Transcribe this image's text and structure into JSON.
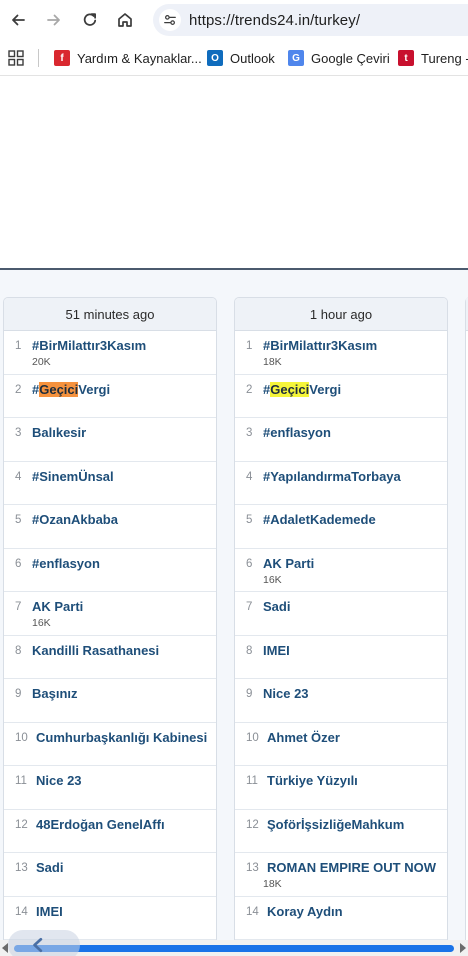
{
  "browser": {
    "url": "https://trends24.in/turkey/",
    "bookmarks": [
      {
        "label": "Yardım & Kaynaklar...",
        "icon": "help-resources-icon",
        "color": "#d9282f",
        "glyph": "f"
      },
      {
        "label": "Outlook",
        "icon": "outlook-icon",
        "color": "#0f6cbd",
        "glyph": "O"
      },
      {
        "label": "Google Çeviri",
        "icon": "google-translate-icon",
        "color": "#4f86ec",
        "glyph": "G"
      },
      {
        "label": "Tureng -",
        "icon": "tureng-icon",
        "color": "#c8102e",
        "glyph": "t"
      }
    ]
  },
  "columns": [
    {
      "header": "51 minutes ago",
      "trends": [
        {
          "rank": "1",
          "parts": [
            {
              "text": "#BirMilattır3Kasım"
            }
          ],
          "count": "20K"
        },
        {
          "rank": "2",
          "parts": [
            {
              "text": "#"
            },
            {
              "text": "Geçici",
              "hl": "orange"
            },
            {
              "text": "Vergi"
            }
          ],
          "count": ""
        },
        {
          "rank": "3",
          "parts": [
            {
              "text": "Balıkesir"
            }
          ],
          "count": ""
        },
        {
          "rank": "4",
          "parts": [
            {
              "text": "#SinemÜnsal"
            }
          ],
          "count": ""
        },
        {
          "rank": "5",
          "parts": [
            {
              "text": "#OzanAkbaba"
            }
          ],
          "count": ""
        },
        {
          "rank": "6",
          "parts": [
            {
              "text": "#enflasyon"
            }
          ],
          "count": ""
        },
        {
          "rank": "7",
          "parts": [
            {
              "text": "AK Parti"
            }
          ],
          "count": "16K"
        },
        {
          "rank": "8",
          "parts": [
            {
              "text": "Kandilli Rasathanesi"
            }
          ],
          "count": ""
        },
        {
          "rank": "9",
          "parts": [
            {
              "text": "Başınız"
            }
          ],
          "count": ""
        },
        {
          "rank": "10",
          "parts": [
            {
              "text": "Cumhurbaşkanlığı Kabinesi"
            }
          ],
          "count": ""
        },
        {
          "rank": "11",
          "parts": [
            {
              "text": "Nice 23"
            }
          ],
          "count": ""
        },
        {
          "rank": "12",
          "parts": [
            {
              "text": "48Erdoğan GenelAffı"
            }
          ],
          "count": ""
        },
        {
          "rank": "13",
          "parts": [
            {
              "text": "Sadi"
            }
          ],
          "count": ""
        },
        {
          "rank": "14",
          "parts": [
            {
              "text": "IMEI"
            }
          ],
          "count": ""
        }
      ]
    },
    {
      "header": "1 hour ago",
      "trends": [
        {
          "rank": "1",
          "parts": [
            {
              "text": "#BirMilattır3Kasım"
            }
          ],
          "count": "18K"
        },
        {
          "rank": "2",
          "parts": [
            {
              "text": "#"
            },
            {
              "text": "Geçici",
              "hl": "yellow"
            },
            {
              "text": "Vergi"
            }
          ],
          "count": ""
        },
        {
          "rank": "3",
          "parts": [
            {
              "text": "#enflasyon"
            }
          ],
          "count": ""
        },
        {
          "rank": "4",
          "parts": [
            {
              "text": "#YapılandırmaTorbaya"
            }
          ],
          "count": ""
        },
        {
          "rank": "5",
          "parts": [
            {
              "text": "#AdaletKademede"
            }
          ],
          "count": ""
        },
        {
          "rank": "6",
          "parts": [
            {
              "text": "AK Parti"
            }
          ],
          "count": "16K"
        },
        {
          "rank": "7",
          "parts": [
            {
              "text": "Sadi"
            }
          ],
          "count": ""
        },
        {
          "rank": "8",
          "parts": [
            {
              "text": "IMEI"
            }
          ],
          "count": ""
        },
        {
          "rank": "9",
          "parts": [
            {
              "text": "Nice 23"
            }
          ],
          "count": ""
        },
        {
          "rank": "10",
          "parts": [
            {
              "text": "Ahmet Özer"
            }
          ],
          "count": ""
        },
        {
          "rank": "11",
          "parts": [
            {
              "text": "Türkiye Yüzyılı"
            }
          ],
          "count": ""
        },
        {
          "rank": "12",
          "parts": [
            {
              "text": "ŞoförİşsizliğeMahkum"
            }
          ],
          "count": ""
        },
        {
          "rank": "13",
          "parts": [
            {
              "text": "ROMAN EMPIRE OUT NOW"
            }
          ],
          "count": "18K"
        },
        {
          "rank": "14",
          "parts": [
            {
              "text": "Koray Aydın"
            }
          ],
          "count": ""
        }
      ]
    }
  ],
  "colors": {
    "trend_link": "#1e4e79",
    "highlight_orange": "#f5923e",
    "highlight_yellow": "#f5f53a",
    "scroll_thumb": "#1a73e8"
  }
}
